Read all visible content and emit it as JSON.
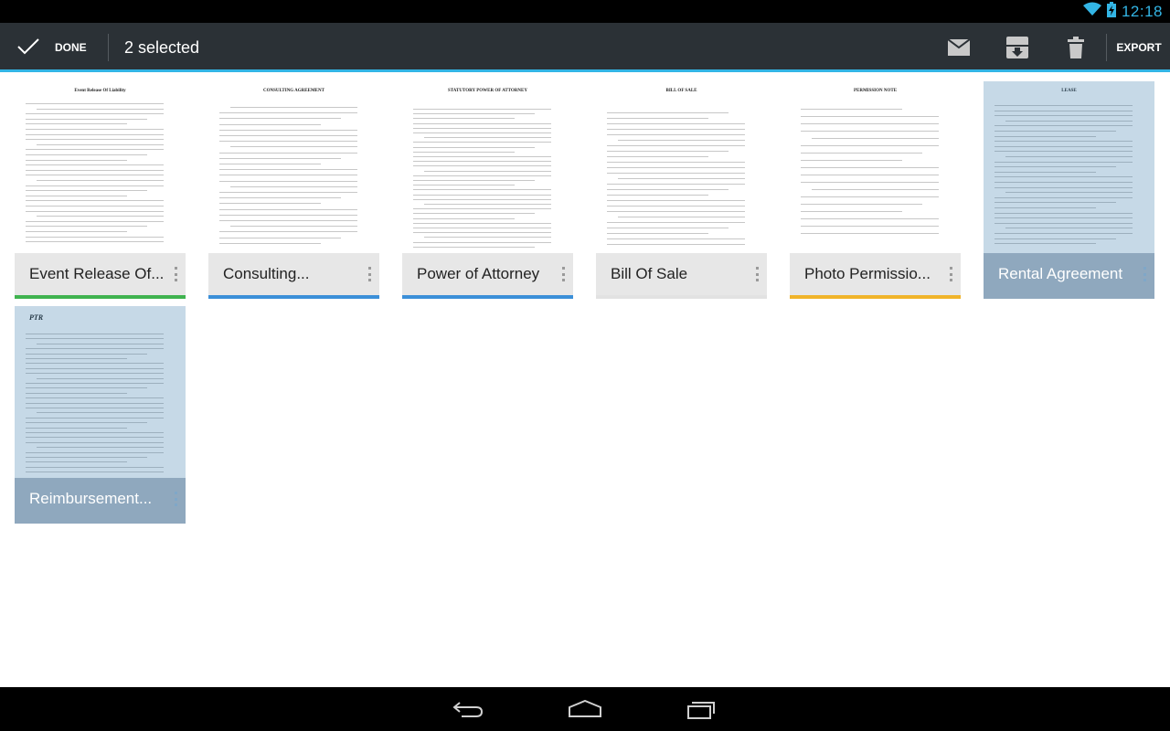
{
  "status_bar": {
    "time": "12:18",
    "icons": [
      "wifi-icon",
      "battery-charging-icon"
    ]
  },
  "action_bar": {
    "done_label": "DONE",
    "title": "2 selected",
    "actions": [
      "email-icon",
      "archive-download-icon",
      "delete-icon"
    ],
    "export_label": "EXPORT",
    "accent_color": "#33b5e5"
  },
  "documents": [
    {
      "label": "Event Release Of...",
      "doc_title": "Event Release Of Liability",
      "accent": "#3fb34f",
      "selected": false
    },
    {
      "label": "Consulting...",
      "doc_title": "CONSULTING AGREEMENT",
      "accent": "#3b8fd8",
      "selected": false
    },
    {
      "label": "Power of Attorney",
      "doc_title": "STATUTORY POWER OF ATTORNEY",
      "accent": "#3b8fd8",
      "selected": false
    },
    {
      "label": "Bill Of Sale",
      "doc_title": "BILL OF SALE",
      "accent": "#e2e2e2",
      "selected": false
    },
    {
      "label": "Photo Permissio...",
      "doc_title": "PERMISSION NOTE",
      "accent": "#f0b42a",
      "selected": false
    },
    {
      "label": "Rental Agreement",
      "doc_title": "LEASE",
      "accent": "#8fa8be",
      "selected": true
    },
    {
      "label": "Reimbursement...",
      "doc_title": "PTR",
      "accent": "#8fa8be",
      "selected": true
    }
  ],
  "nav_bar": {
    "buttons": [
      "back-icon",
      "home-icon",
      "recent-apps-icon"
    ]
  }
}
